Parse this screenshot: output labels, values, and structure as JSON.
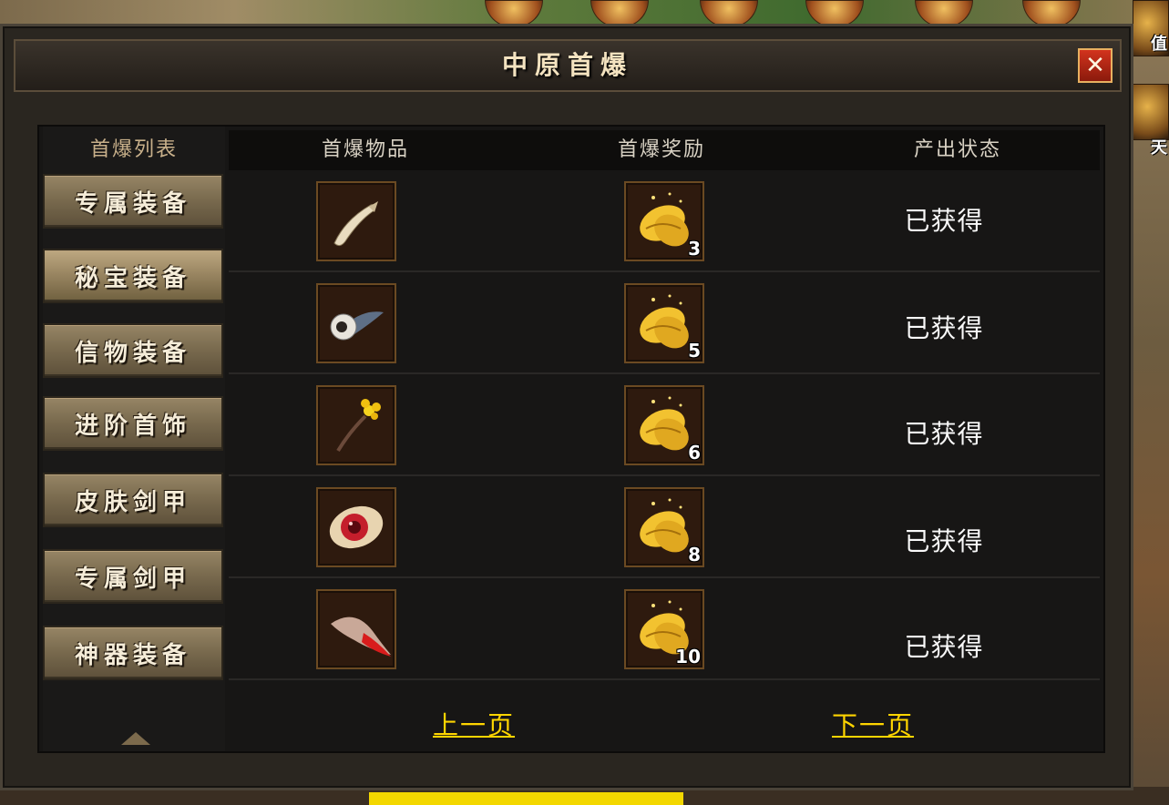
{
  "window": {
    "title": "中原首爆",
    "close_icon": "close-icon"
  },
  "sidebar": {
    "header": "首爆列表",
    "items": [
      {
        "label": "专属装备",
        "active": false
      },
      {
        "label": "秘宝装备",
        "active": true
      },
      {
        "label": "信物装备",
        "active": false
      },
      {
        "label": "进阶首饰",
        "active": false
      },
      {
        "label": "皮肤剑甲",
        "active": false
      },
      {
        "label": "专属剑甲",
        "active": false
      },
      {
        "label": "神器装备",
        "active": false
      }
    ]
  },
  "table": {
    "headers": [
      "首爆物品",
      "首爆奖励",
      "产出状态"
    ],
    "rows": [
      {
        "item_icon": "tooth-icon",
        "reward_icon": "gold-leaf-icon",
        "reward_count": "3",
        "status": "已获得"
      },
      {
        "item_icon": "eyeball-icon",
        "reward_icon": "gold-leaf-icon",
        "reward_count": "5",
        "status": "已获得"
      },
      {
        "item_icon": "flower-icon",
        "reward_icon": "gold-leaf-icon",
        "reward_count": "6",
        "status": "已获得"
      },
      {
        "item_icon": "red-eye-icon",
        "reward_icon": "gold-leaf-icon",
        "reward_count": "8",
        "status": "已获得"
      },
      {
        "item_icon": "red-feather-icon",
        "reward_icon": "gold-leaf-icon",
        "reward_count": "10",
        "status": "已获得"
      }
    ]
  },
  "pager": {
    "prev_label": "上一页",
    "next_label": "下一页"
  },
  "side_labels": [
    "值",
    "天"
  ],
  "colors": {
    "pager": "#ffd500",
    "close_button": "#c62a18",
    "title": "#f4e3c0"
  }
}
